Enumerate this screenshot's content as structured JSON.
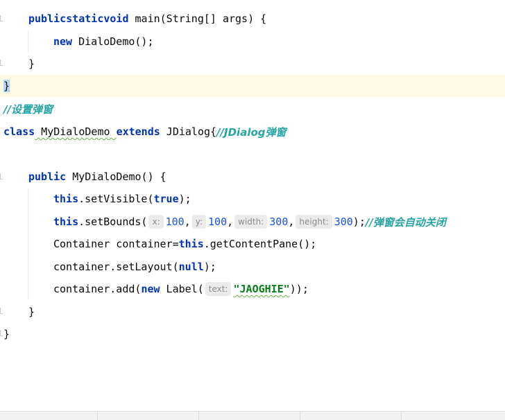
{
  "code": {
    "l1": {
      "kw1": "public",
      "kw2": "static",
      "kw3": "void",
      "rest": " main(String[] args) {"
    },
    "l2": {
      "kw": "new",
      "rest": " DialoDemo();"
    },
    "l3": {
      "brace": "}"
    },
    "l4": {
      "brace": "}"
    },
    "l5": {
      "comment": "//设置弹窗"
    },
    "l6": {
      "kw1": "class",
      "name": " MyDialoDemo ",
      "kw2": "extends",
      "rest": " JDialog{",
      "comment": "//JDialog弹窗"
    },
    "l7": {
      "kw": "public",
      "rest": " MyDialoDemo() {"
    },
    "l8": {
      "kw1": "this",
      "mid": ".setVisible(",
      "kw2": "true",
      "rest": ");"
    },
    "l9": {
      "kw": "this",
      "mid": ".setBounds(",
      "hint_x": "x:",
      "v_x": "100",
      "hint_y": "y:",
      "v_y": "100",
      "hint_w": "width:",
      "v_w": "300",
      "hint_h": "height:",
      "v_h": "300",
      "end": ");",
      "comment": "//弹窗会自动关闭"
    },
    "l10": {
      "pre": "Container container=",
      "kw": "this",
      "rest": ".getContentPane();"
    },
    "l11": {
      "pre": "container.setLayout(",
      "kw": "null",
      "rest": ");"
    },
    "l12": {
      "pre": "container.add(",
      "kw": "new",
      "mid": " Label(",
      "hint": "text:",
      "str": "\"JAOGHIE\"",
      "rest": "));"
    },
    "l13": {
      "brace": "}"
    },
    "l14": {
      "brace": "}"
    }
  }
}
